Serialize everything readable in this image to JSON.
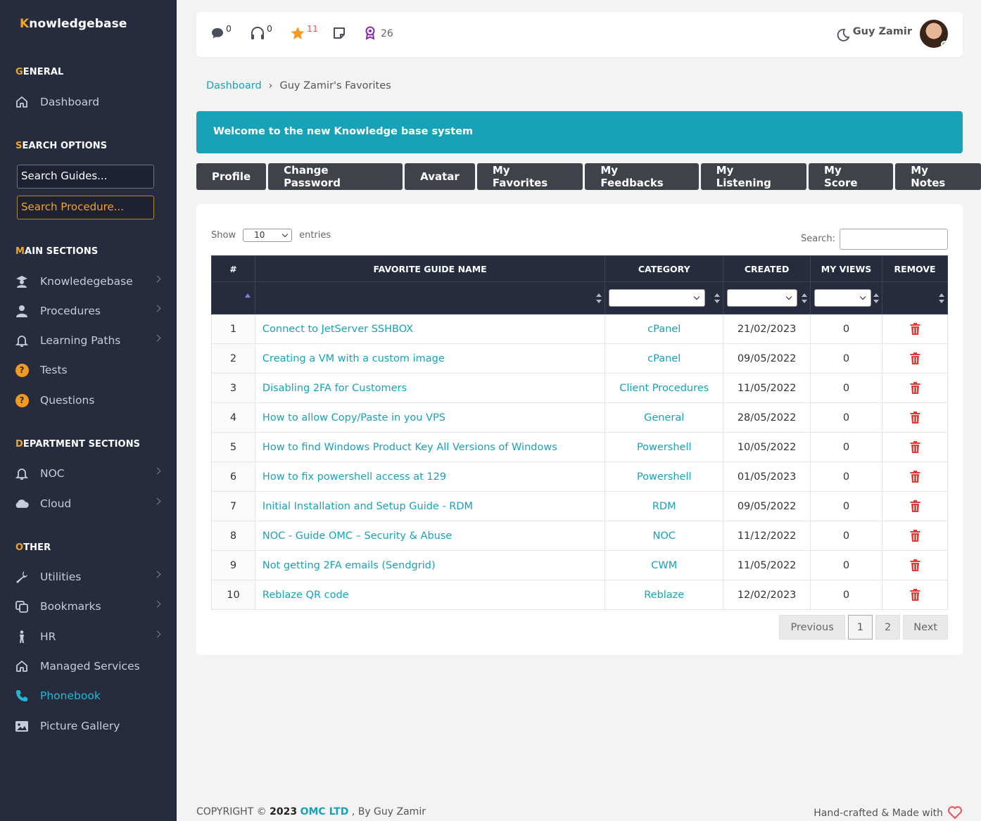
{
  "brand": {
    "first": "K",
    "rest": "nowledgebase"
  },
  "sidebar": {
    "general": {
      "first": "G",
      "rest": "ENERAL"
    },
    "dashboard": "Dashboard",
    "search_options": {
      "first": "S",
      "rest": "EARCH OPTIONS"
    },
    "search_guides_placeholder": "Search Guides...",
    "search_procedure_placeholder": "Search Procedure...",
    "main_sections": {
      "first": "M",
      "rest": "AIN SECTIONS"
    },
    "main_items": [
      "Knowledegebase",
      "Procedures",
      "Learning Paths",
      "Tests",
      "Questions"
    ],
    "department_sections": {
      "first": "D",
      "rest": "EPARTMENT SECTIONS"
    },
    "department_items": [
      "NOC",
      "Cloud"
    ],
    "other": {
      "first": "O",
      "rest": "THER"
    },
    "other_items": [
      "Utilities",
      "Bookmarks",
      "HR",
      "Managed Services",
      "Phonebook",
      "Picture Gallery"
    ]
  },
  "topbar": {
    "messages_count": "0",
    "listening_count": "0",
    "favorites_count": "11",
    "notes_count": "",
    "score": "26",
    "user_name": "Guy Zamir"
  },
  "breadcrumb": {
    "home": "Dashboard",
    "current": "Guy Zamir's Favorites"
  },
  "banner": "Welcome to the new Knowledge base system",
  "tabs": [
    "Profile",
    "Change Password",
    "Avatar",
    "My Favorites",
    "My Feedbacks",
    "My Listening",
    "My Score",
    "My Notes"
  ],
  "table": {
    "show_label": "Show",
    "entries_value": "10",
    "entries_label": "entries",
    "search_label": "Search:",
    "headers": [
      "#",
      "FAVORITE GUIDE NAME",
      "CATEGORY",
      "CREATED",
      "MY VIEWS",
      "REMOVE"
    ],
    "rows": [
      {
        "n": "1",
        "name": "Connect to JetServer SSHBOX",
        "category": "cPanel",
        "created": "21/02/2023",
        "views": "0"
      },
      {
        "n": "2",
        "name": "Creating a VM with a custom image",
        "category": "cPanel",
        "created": "09/05/2022",
        "views": "0"
      },
      {
        "n": "3",
        "name": "Disabling 2FA for Customers",
        "category": "Client Procedures",
        "created": "11/05/2022",
        "views": "0"
      },
      {
        "n": "4",
        "name": "How to allow Copy/Paste in you VPS",
        "category": "General",
        "created": "28/05/2022",
        "views": "0"
      },
      {
        "n": "5",
        "name": "How to find Windows Product Key All Versions of Windows",
        "category": "Powershell",
        "created": "10/05/2022",
        "views": "0"
      },
      {
        "n": "6",
        "name": "How to fix powershell access at 129",
        "category": "Powershell",
        "created": "01/05/2023",
        "views": "0"
      },
      {
        "n": "7",
        "name": "Initial Installation and Setup Guide - RDM",
        "category": "RDM",
        "created": "09/05/2022",
        "views": "0"
      },
      {
        "n": "8",
        "name": "NOC - Guide OMC – Security & Abuse",
        "category": "NOC",
        "created": "11/12/2022",
        "views": "0"
      },
      {
        "n": "9",
        "name": "Not getting 2FA emails (Sendgrid)",
        "category": "CWM",
        "created": "11/05/2022",
        "views": "0"
      },
      {
        "n": "10",
        "name": "Reblaze QR code",
        "category": "Reblaze",
        "created": "12/02/2023",
        "views": "0"
      }
    ],
    "pagination": {
      "previous": "Previous",
      "pages": [
        "1",
        "2"
      ],
      "next": "Next"
    }
  },
  "footer": {
    "copyright": "COPYRIGHT ©",
    "year": "2023",
    "company": "OMC LTD",
    "by": ", By Guy Zamir",
    "made": "Hand-crafted & Made with"
  },
  "colors": {
    "accent": "#17a2b8",
    "sidebar_bg": "#262c3e",
    "brand_orange": "#f3a42a",
    "trash_red": "#e53935"
  },
  "icons": [
    "home-icon",
    "knowledgebase-icon",
    "user-icon",
    "bell-icon",
    "question-icon",
    "cloud-icon",
    "wrench-icon",
    "bookmarks-icon",
    "person-icon",
    "phone-icon",
    "image-icon",
    "chat-icon",
    "headphones-icon",
    "star-icon",
    "note-icon",
    "award-icon",
    "moon-icon",
    "trash-icon",
    "heart-icon"
  ]
}
